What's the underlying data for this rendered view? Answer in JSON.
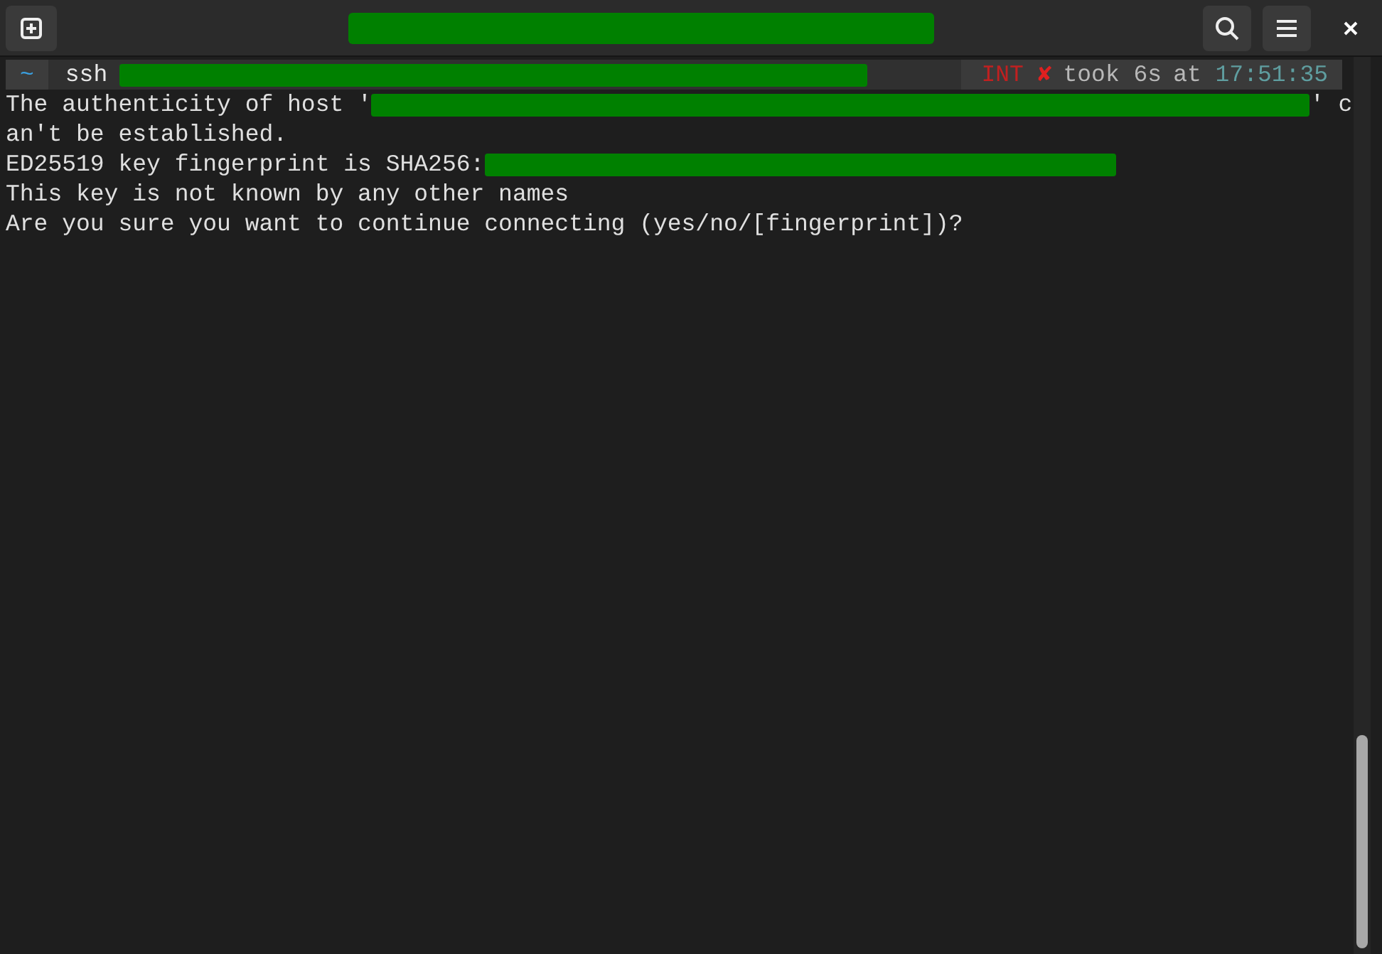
{
  "window": {
    "title_redacted": true
  },
  "prompt": {
    "dir": "~",
    "command": "ssh",
    "status": "INT",
    "status_mark": "✘",
    "duration": "took 6s",
    "time_label": "at",
    "time": "17:51:35"
  },
  "output": [
    {
      "before": "The authenticity of host '",
      "redacted": true,
      "after": "' c"
    },
    {
      "before": "an't be established.",
      "redacted": false
    },
    {
      "before": "ED25519 key fingerprint is SHA256:",
      "redacted": true
    },
    {
      "before": "This key is not known by any other names",
      "redacted": false
    },
    {
      "before": "Are you sure you want to continue connecting (yes/no/[fingerprint])?",
      "redacted": false
    }
  ]
}
